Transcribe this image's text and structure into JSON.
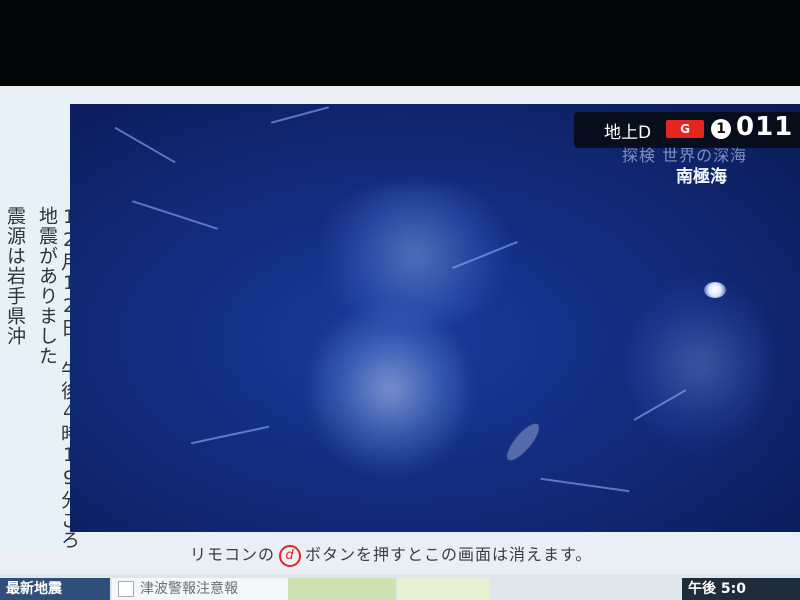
{
  "sidebar": {
    "line1": "12月12日 午後4時19分ごろ地震がありました",
    "line2": "震源は岩手県沖"
  },
  "channel": {
    "network": "地上D",
    "badge": "G",
    "number_circle": "1",
    "number": "011"
  },
  "program": {
    "title_partial": "探検 世界の深海",
    "subtitle": "南極海"
  },
  "notice": {
    "prefix": "リモコンの",
    "button": "d",
    "suffix": "ボタンを押すとこの画面は消えます。"
  },
  "bottom_tabs": {
    "latest": "最新地震",
    "tsunami": "津波警報注意報",
    "green": "",
    "info": "",
    "time": "午後 5:0"
  },
  "colors": {
    "accent_red": "#e5261f",
    "video_blue": "#142f86"
  }
}
